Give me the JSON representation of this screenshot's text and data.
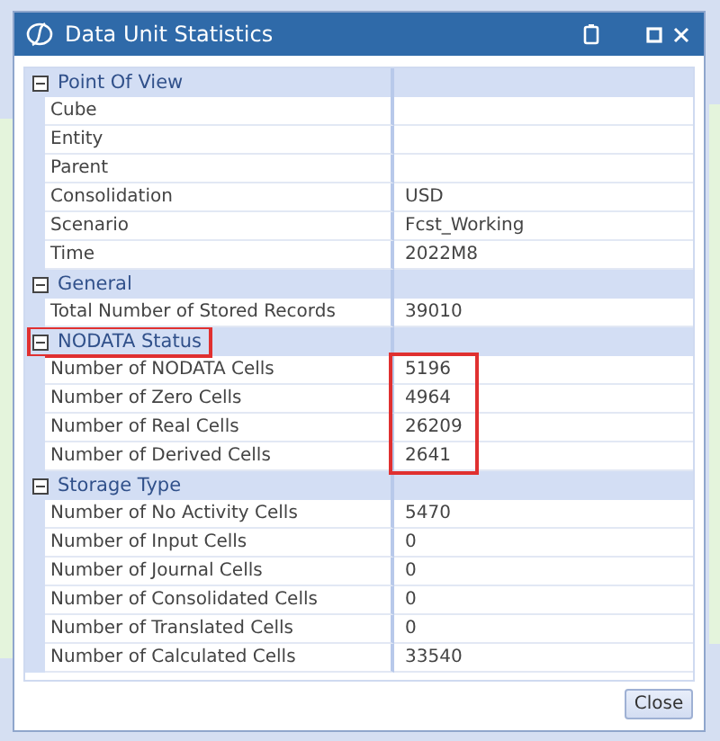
{
  "window": {
    "title": "Data Unit Statistics"
  },
  "groups": [
    {
      "label": "Point Of View",
      "expanded": true,
      "highlighted": false,
      "values_highlighted": false,
      "rows": [
        {
          "label": "Cube"
        },
        {
          "label": "Entity"
        },
        {
          "label": "Parent"
        },
        {
          "label": "Consolidation",
          "value": "USD"
        },
        {
          "label": "Scenario",
          "value": "Fcst_Working"
        },
        {
          "label": "Time",
          "value": "2022M8"
        }
      ]
    },
    {
      "label": "General",
      "expanded": true,
      "highlighted": false,
      "values_highlighted": false,
      "rows": [
        {
          "label": "Total Number of Stored Records",
          "value": "39010"
        }
      ]
    },
    {
      "label": "NODATA Status",
      "expanded": true,
      "highlighted": true,
      "values_highlighted": true,
      "rows": [
        {
          "label": "Number of NODATA Cells",
          "value": "5196"
        },
        {
          "label": "Number of Zero Cells",
          "value": "4964"
        },
        {
          "label": "Number of Real Cells",
          "value": "26209"
        },
        {
          "label": "Number of Derived Cells",
          "value": "2641"
        }
      ]
    },
    {
      "label": "Storage Type",
      "expanded": true,
      "highlighted": false,
      "values_highlighted": false,
      "rows": [
        {
          "label": "Number of No Activity Cells",
          "value": "5470"
        },
        {
          "label": "Number of Input Cells",
          "value": "0"
        },
        {
          "label": "Number of Journal Cells",
          "value": "0"
        },
        {
          "label": "Number of Consolidated Cells",
          "value": "0"
        },
        {
          "label": "Number of Translated Cells",
          "value": "0"
        },
        {
          "label": "Number of Calculated Cells",
          "value": "33540"
        }
      ]
    }
  ],
  "buttons": [
    {
      "label": "Close"
    }
  ]
}
